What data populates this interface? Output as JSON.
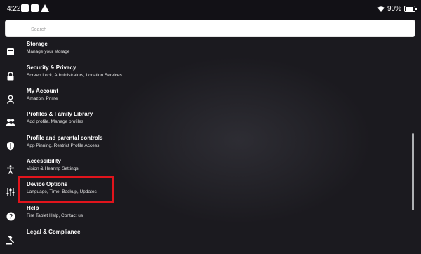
{
  "status_bar": {
    "time": "4:22",
    "battery_text": "90%"
  },
  "search": {
    "placeholder": "Search"
  },
  "settings_items": [
    {
      "title": "Storage",
      "subtitle": "Manage your storage",
      "icon": "storage-icon"
    },
    {
      "title": "Security & Privacy",
      "subtitle": "Screen Lock, Administrators, Location Services",
      "icon": "lock-icon"
    },
    {
      "title": "My Account",
      "subtitle": "Amazon, Prime",
      "icon": "person-icon"
    },
    {
      "title": "Profiles & Family Library",
      "subtitle": "Add profile, Manage profiles",
      "icon": "people-icon"
    },
    {
      "title": "Profile and parental controls",
      "subtitle": "App Pinning, Restrict Profile Access",
      "icon": "shield-icon"
    },
    {
      "title": "Accessibility",
      "subtitle": "Vision & Hearing Settings",
      "icon": "accessibility-icon"
    },
    {
      "title": "Device Options",
      "subtitle": "Language, Time, Backup, Updates",
      "icon": "sliders-icon"
    },
    {
      "title": "Help",
      "subtitle": "Fire Tablet Help, Contact us",
      "icon": "help-icon"
    },
    {
      "title": "Legal & Compliance",
      "subtitle": "",
      "icon": "gavel-icon"
    }
  ],
  "colors": {
    "background": "#1b1a1f",
    "highlight": "#e1141c",
    "text": "#ffffff"
  }
}
